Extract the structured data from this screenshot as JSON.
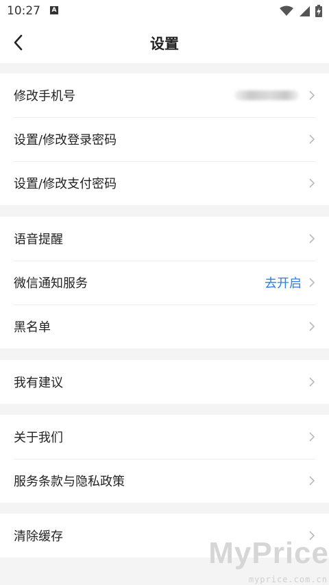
{
  "status_bar": {
    "time": "10:27",
    "notification_icon": "a-letter-icon",
    "icons": [
      "wifi-icon",
      "signal-icon",
      "battery-charging-icon"
    ]
  },
  "header": {
    "title": "设置",
    "back_icon": "chevron-left-icon"
  },
  "groups": [
    {
      "items": [
        {
          "label": "修改手机号",
          "value_hidden": true
        },
        {
          "label": "设置/修改登录密码"
        },
        {
          "label": "设置/修改支付密码"
        }
      ]
    },
    {
      "items": [
        {
          "label": "语音提醒"
        },
        {
          "label": "微信通知服务",
          "action": "去开启"
        },
        {
          "label": "黑名单"
        }
      ]
    },
    {
      "items": [
        {
          "label": "我有建议"
        }
      ]
    },
    {
      "items": [
        {
          "label": "关于我们"
        },
        {
          "label": "服务条款与隐私政策"
        }
      ]
    },
    {
      "items": [
        {
          "label": "清除缓存"
        }
      ]
    }
  ],
  "watermark": {
    "main": "MyPrice",
    "sub": "myprice.com.cn"
  },
  "colors": {
    "accent": "#2b7de9",
    "background": "#f4f4f5",
    "divider": "#ededed"
  }
}
